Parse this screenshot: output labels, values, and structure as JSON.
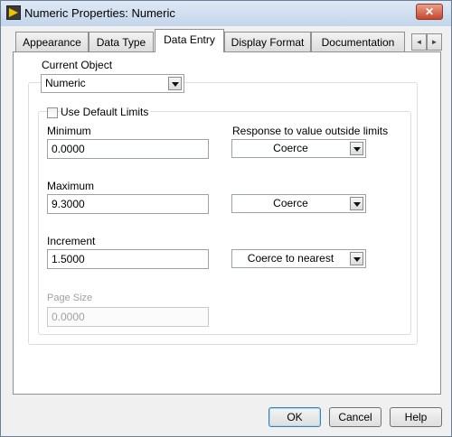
{
  "window": {
    "title": "Numeric Properties: Numeric",
    "close_glyph": "✕"
  },
  "tabs": [
    {
      "label": "Appearance"
    },
    {
      "label": "Data Type"
    },
    {
      "label": "Data Entry",
      "active": true
    },
    {
      "label": "Display Format"
    },
    {
      "label": "Documentation"
    }
  ],
  "tab_scroll": {
    "left": "◄",
    "right": "►"
  },
  "current_object": {
    "label": "Current Object",
    "value": "Numeric"
  },
  "use_default_limits": {
    "label": "Use Default Limits",
    "checked": false
  },
  "response_label": "Response to value outside limits",
  "minimum": {
    "label": "Minimum",
    "value": "0.0000",
    "response": "Coerce"
  },
  "maximum": {
    "label": "Maximum",
    "value": "9.3000",
    "response": "Coerce"
  },
  "increment": {
    "label": "Increment",
    "value": "1.5000",
    "response": "Coerce to nearest"
  },
  "page_size": {
    "label": "Page Size",
    "value": "0.0000",
    "enabled": false
  },
  "buttons": {
    "ok": "OK",
    "cancel": "Cancel",
    "help": "Help"
  }
}
